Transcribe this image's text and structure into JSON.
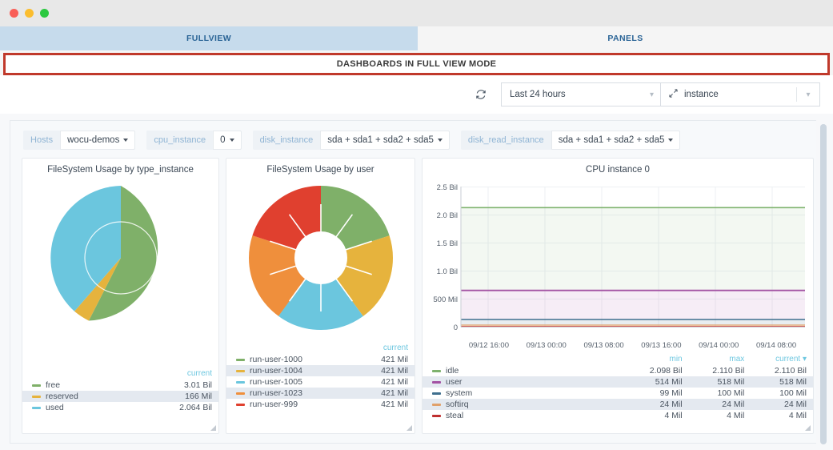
{
  "window": {
    "controls": [
      "close",
      "minimize",
      "maximize"
    ]
  },
  "tabs": [
    {
      "id": "fullview",
      "label": "FULLVIEW",
      "active": true
    },
    {
      "id": "panels",
      "label": "PANELS",
      "active": false
    }
  ],
  "banner": {
    "text": "DASHBOARDS IN FULL VIEW MODE",
    "border_color": "#c0392b"
  },
  "toolbar": {
    "refresh_icon": "refresh-icon",
    "time_range": {
      "value": "Last 24 hours",
      "chevron": "chevron-down-icon"
    },
    "instance": {
      "icon": "expand-arrows-icon",
      "value": "instance",
      "chevron": "chevron-down-icon"
    }
  },
  "variables": [
    {
      "label": "Hosts",
      "value": "wocu-demos"
    },
    {
      "label": "cpu_instance",
      "value": "0"
    },
    {
      "label": "disk_instance",
      "value": "sda + sda1 + sda2 + sda5"
    },
    {
      "label": "disk_read_instance",
      "value": "sda + sda1 + sda2 + sda5"
    }
  ],
  "panels": [
    {
      "id": "filesystem-by-type-instance",
      "title": "FileSystem Usage by type_instance",
      "legend_header": "current",
      "chart_data": {
        "type": "pie",
        "title": "FileSystem Usage by type_instance",
        "labels": [
          "free",
          "reserved",
          "used"
        ],
        "values": [
          3.01,
          0.166,
          2.064
        ],
        "value_labels": [
          "3.01 Bil",
          "166 Mil",
          "2.064 Bil"
        ],
        "colors": [
          "#7fb069",
          "#e6b33d",
          "#6bc6de"
        ],
        "units": "bytes",
        "inner_ring_outline": true
      },
      "rows": [
        {
          "name": "free",
          "current": "3.01 Bil",
          "color": "#7fb069"
        },
        {
          "name": "reserved",
          "current": "166 Mil",
          "color": "#e6b33d"
        },
        {
          "name": "used",
          "current": "2.064 Bil",
          "color": "#6bc6de"
        }
      ]
    },
    {
      "id": "filesystem-by-user",
      "title": "FileSystem Usage by user",
      "legend_header": "current",
      "chart_data": {
        "type": "pie",
        "title": "FileSystem Usage by user",
        "labels": [
          "run-user-1000",
          "run-user-1004",
          "run-user-1005",
          "run-user-1023",
          "run-user-999"
        ],
        "values": [
          421,
          421,
          421,
          421,
          421
        ],
        "value_labels": [
          "421 Mil",
          "421 Mil",
          "421 Mil",
          "421 Mil",
          "421 Mil"
        ],
        "colors": [
          "#7fb069",
          "#e6b33d",
          "#6bc6de",
          "#ef8f3c",
          "#e0402f"
        ],
        "units": "bytes",
        "donut": true
      },
      "rows": [
        {
          "name": "run-user-1000",
          "current": "421 Mil",
          "color": "#7fb069"
        },
        {
          "name": "run-user-1004",
          "current": "421 Mil",
          "color": "#e6b33d"
        },
        {
          "name": "run-user-1005",
          "current": "421 Mil",
          "color": "#6bc6de"
        },
        {
          "name": "run-user-1023",
          "current": "421 Mil",
          "color": "#ef8f3c"
        },
        {
          "name": "run-user-999",
          "current": "421 Mil",
          "color": "#e0402f"
        }
      ]
    },
    {
      "id": "cpu-instance-0",
      "title": "CPU instance 0",
      "legend_headers": [
        "min",
        "max",
        "current"
      ],
      "sort_indicator": "current",
      "chart_data": {
        "type": "area",
        "title": "CPU instance 0",
        "stacked": true,
        "ylabel": "",
        "xlabel": "",
        "ylim": [
          0,
          2500000000
        ],
        "ytick_labels": [
          "0",
          "500 Mil",
          "1.0 Bil",
          "1.5 Bil",
          "2.0 Bil",
          "2.5 Bil"
        ],
        "ytick_values": [
          0,
          500000000,
          1000000000,
          1500000000,
          2000000000,
          2500000000
        ],
        "xtick_labels": [
          "09/12 16:00",
          "09/13 00:00",
          "09/13 08:00",
          "09/13 16:00",
          "09/14 00:00",
          "09/14 08:00"
        ],
        "grid": true,
        "series": [
          {
            "name": "steal",
            "color": "#bf3030",
            "value": 4000000,
            "min": "4 Mil",
            "max": "4 Mil",
            "current": "4 Mil"
          },
          {
            "name": "softirq",
            "color": "#e0a06a",
            "value": 24000000,
            "min": "24 Mil",
            "max": "24 Mil",
            "current": "24 Mil"
          },
          {
            "name": "system",
            "color": "#3f6f8e",
            "value": 100000000,
            "min": "99 Mil",
            "max": "100 Mil",
            "current": "100 Mil"
          },
          {
            "name": "user",
            "color": "#a352a3",
            "value": 518000000,
            "min": "514 Mil",
            "max": "518 Mil",
            "current": "518 Mil"
          },
          {
            "name": "idle",
            "color": "#7eb26d",
            "value": 2110000000,
            "min": "2.098 Bil",
            "max": "2.110 Bil",
            "current": "2.110 Bil"
          }
        ]
      },
      "rows": [
        {
          "name": "idle",
          "min": "2.098 Bil",
          "max": "2.110 Bil",
          "current": "2.110 Bil",
          "color": "#7eb26d"
        },
        {
          "name": "user",
          "min": "514 Mil",
          "max": "518 Mil",
          "current": "518 Mil",
          "color": "#a352a3"
        },
        {
          "name": "system",
          "min": "99 Mil",
          "max": "100 Mil",
          "current": "100 Mil",
          "color": "#3f6f8e"
        },
        {
          "name": "softirq",
          "min": "24 Mil",
          "max": "24 Mil",
          "current": "24 Mil",
          "color": "#e0a06a"
        },
        {
          "name": "steal",
          "min": "4 Mil",
          "max": "4 Mil",
          "current": "4 Mil",
          "color": "#bf3030"
        }
      ]
    }
  ]
}
